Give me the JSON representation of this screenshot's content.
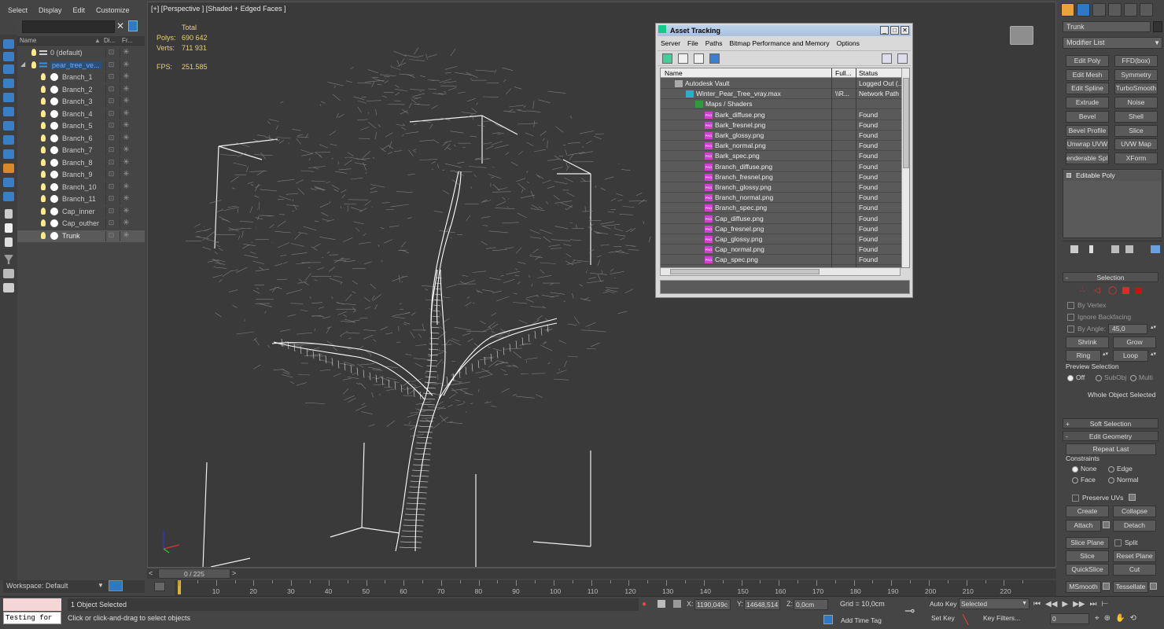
{
  "menu": [
    "Select",
    "Display",
    "Edit",
    "Customize"
  ],
  "explorer": {
    "search_value": "",
    "columns": [
      "Name",
      "Di...",
      "Fr..."
    ],
    "rows": [
      {
        "label": "0 (default)",
        "kind": "layer"
      },
      {
        "label": "pear_tree_ve...",
        "kind": "layer-selected"
      },
      {
        "label": "Branch_1",
        "kind": "object"
      },
      {
        "label": "Branch_2",
        "kind": "object"
      },
      {
        "label": "Branch_3",
        "kind": "object"
      },
      {
        "label": "Branch_4",
        "kind": "object"
      },
      {
        "label": "Branch_5",
        "kind": "object"
      },
      {
        "label": "Branch_6",
        "kind": "object"
      },
      {
        "label": "Branch_7",
        "kind": "object"
      },
      {
        "label": "Branch_8",
        "kind": "object"
      },
      {
        "label": "Branch_9",
        "kind": "object"
      },
      {
        "label": "Branch_10",
        "kind": "object"
      },
      {
        "label": "Branch_11",
        "kind": "object"
      },
      {
        "label": "Cap_inner",
        "kind": "object"
      },
      {
        "label": "Cap_outher",
        "kind": "object"
      },
      {
        "label": "Trunk",
        "kind": "object-highlight"
      }
    ],
    "workspace": "Workspace: Default"
  },
  "viewport": {
    "label": "[+] [Perspective ] [Shaded + Edged Faces ]",
    "stats": {
      "total_label": "Total",
      "polys_label": "Polys:",
      "polys_value": "690 642",
      "verts_label": "Verts:",
      "verts_value": "711 931",
      "fps_label": "FPS:",
      "fps_value": "251.585"
    }
  },
  "asset_tracking": {
    "title": "Asset Tracking",
    "menu": [
      "Server",
      "File",
      "Paths",
      "Bitmap Performance and Memory",
      "Options"
    ],
    "columns": [
      "Name",
      "Full...",
      "Status"
    ],
    "rows": [
      {
        "name": "Autodesk Vault",
        "full": "",
        "status": "Logged Out (..."
      },
      {
        "name": "Winter_Pear_Tree_vray.max",
        "full": "\\\\R...",
        "status": "Network Path"
      },
      {
        "name": "Maps / Shaders",
        "full": "",
        "status": ""
      },
      {
        "name": "Bark_diffuse.png",
        "full": "",
        "status": "Found"
      },
      {
        "name": "Bark_fresnel.png",
        "full": "",
        "status": "Found"
      },
      {
        "name": "Bark_glossy.png",
        "full": "",
        "status": "Found"
      },
      {
        "name": "Bark_normal.png",
        "full": "",
        "status": "Found"
      },
      {
        "name": "Bark_spec.png",
        "full": "",
        "status": "Found"
      },
      {
        "name": "Branch_diffuse.png",
        "full": "",
        "status": "Found"
      },
      {
        "name": "Branch_fresnel.png",
        "full": "",
        "status": "Found"
      },
      {
        "name": "Branch_glossy.png",
        "full": "",
        "status": "Found"
      },
      {
        "name": "Branch_normal.png",
        "full": "",
        "status": "Found"
      },
      {
        "name": "Branch_spec.png",
        "full": "",
        "status": "Found"
      },
      {
        "name": "Cap_diffuse.png",
        "full": "",
        "status": "Found"
      },
      {
        "name": "Cap_fresnel.png",
        "full": "",
        "status": "Found"
      },
      {
        "name": "Cap_glossy.png",
        "full": "",
        "status": "Found"
      },
      {
        "name": "Cap_normal.png",
        "full": "",
        "status": "Found"
      },
      {
        "name": "Cap_spec.png",
        "full": "",
        "status": "Found"
      }
    ],
    "png_badge": "PNG"
  },
  "command_panel": {
    "object_name": "Trunk",
    "modifier_list": "Modifier List",
    "modifier_buttons": [
      "Edit Poly",
      "FFD(box)",
      "Edit Mesh",
      "Symmetry",
      "Edit Spline",
      "TurboSmooth",
      "Extrude",
      "Noise",
      "Bevel",
      "Shell",
      "Bevel Profile",
      "Slice",
      "Unwrap UVW",
      "UVW Map",
      "enderable Splir",
      "XForm"
    ],
    "stack_item": "Editable Poly",
    "selection": {
      "title": "Selection",
      "by_vertex": "By Vertex",
      "ignore_backfacing": "Ignore Backfacing",
      "by_angle": "By Angle:",
      "angle_value": "45,0",
      "shrink": "Shrink",
      "grow": "Grow",
      "ring": "Ring",
      "loop": "Loop",
      "preview_label": "Preview Selection",
      "preview_off": "Off",
      "preview_subobj": "SubObj",
      "preview_multi": "Multi",
      "status": "Whole Object Selected"
    },
    "soft_selection": "Soft Selection",
    "edit_geometry": {
      "title": "Edit Geometry",
      "repeat_last": "Repeat Last",
      "constraints": "Constraints",
      "none": "None",
      "edge": "Edge",
      "face": "Face",
      "normal": "Normal",
      "preserve_uvs": "Preserve UVs",
      "create": "Create",
      "collapse": "Collapse",
      "attach": "Attach",
      "detach": "Detach",
      "slice_plane": "Slice Plane",
      "split": "Split",
      "slice": "Slice",
      "reset_plane": "Reset Plane",
      "quickslice": "QuickSlice",
      "cut": "Cut",
      "msmooth": "MSmooth",
      "tessellate": "Tessellate"
    }
  },
  "timeline": {
    "frame_label": "0 / 225",
    "ticks": [
      "10",
      "20",
      "30",
      "40",
      "50",
      "60",
      "70",
      "80",
      "90",
      "100",
      "110",
      "120",
      "130",
      "140",
      "150",
      "160",
      "170",
      "180",
      "190",
      "200",
      "210",
      "220"
    ]
  },
  "status": {
    "maxscript": "Testing for",
    "selection_info": "1 Object Selected",
    "prompt": "Click or click-and-drag to select objects",
    "x_label": "X:",
    "x_value": "1190,049c",
    "y_label": "Y:",
    "y_value": "14648,514",
    "z_label": "Z:",
    "z_value": "0,0cm",
    "grid": "Grid = 10,0cm",
    "add_time_tag": "Add Time Tag",
    "auto_key": "Auto Key",
    "set_key": "Set Key",
    "key_mode": "Selected",
    "key_filters": "Key Filters...",
    "frame_value": "0"
  },
  "colors": {
    "accent": "#2e78c8",
    "stat_text": "#e9d36e",
    "png_badge": "#d63fd6"
  }
}
